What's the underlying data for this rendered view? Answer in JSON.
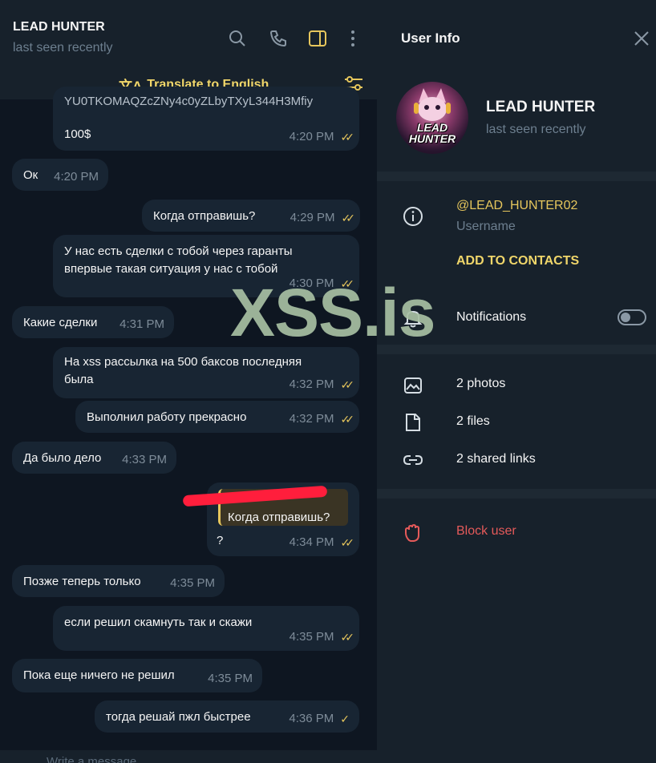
{
  "chat": {
    "title": "LEAD HUNTER",
    "status": "last seen recently",
    "translate": "Translate to English",
    "compose_placeholder": "Write a message..."
  },
  "messages": {
    "m1": {
      "line1": "YU0TKOMAQZcZNy4c0yZLbyTXyL344H3Mfiy",
      "line2": "100$",
      "time": "4:20 PM"
    },
    "m2": {
      "text": "Ок",
      "time": "4:20 PM"
    },
    "m3": {
      "text": "Когда отправишь?",
      "time": "4:29 PM"
    },
    "m4": {
      "line1": "У нас есть сделки с тобой через гаранты",
      "line2": "впервые такая ситуация у нас с тобой",
      "time": "4:30 PM"
    },
    "m5": {
      "text": "Какие сделки",
      "time": "4:31 PM"
    },
    "m6": {
      "line1": "На xss рассылка на 500 баксов последняя",
      "line2": "была",
      "time": "4:32 PM"
    },
    "m7": {
      "text": "Выполнил работу прекрасно",
      "time": "4:32 PM"
    },
    "m8": {
      "text": "Да было дело",
      "time": "4:33 PM"
    },
    "m9": {
      "reply": "Когда отправишь?",
      "text": "?",
      "time": "4:34 PM"
    },
    "m10": {
      "text": "Позже теперь только",
      "time": "4:35 PM"
    },
    "m11": {
      "text": "если решил скамнуть так и скажи",
      "time": "4:35 PM"
    },
    "m12": {
      "text": "Пока еще ничего не решил",
      "time": "4:35 PM"
    },
    "m13": {
      "text": "тогда решай пжл быстрее",
      "time": "4:36 PM"
    }
  },
  "watermark": "XSS.is",
  "panel": {
    "title": "User Info",
    "name": "LEAD HUNTER",
    "status": "last seen recently",
    "avatar_text": "LEAD HUNTER",
    "username": "@LEAD_HUNTER02",
    "username_label": "Username",
    "add_contacts": "ADD TO CONTACTS",
    "notifications": "Notifications",
    "notifications_on": false,
    "photos": "2 photos",
    "files": "2 files",
    "links": "2 shared links",
    "block": "Block user"
  },
  "colors": {
    "accent": "#e6c65c",
    "danger": "#e55a5a",
    "bubble": "#182533",
    "bg": "#0e1621"
  }
}
